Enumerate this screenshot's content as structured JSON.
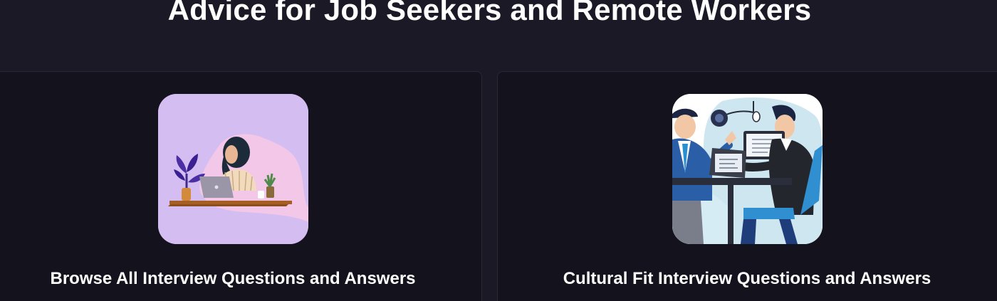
{
  "section": {
    "title": "Advice for Job Seekers and Remote Workers"
  },
  "cards": [
    {
      "title": "Browse All Interview Questions and Answers",
      "image_icon": "woman-working-on-laptop-illustration"
    },
    {
      "title": "Cultural Fit Interview Questions and Answers",
      "image_icon": "two-men-interview-illustration"
    }
  ],
  "colors": {
    "page_background": "#1b1925",
    "card_background": "#14121c",
    "card_border": "#2a2836",
    "text": "#ffffff",
    "thumb_left_background": "#d4bdf1"
  }
}
